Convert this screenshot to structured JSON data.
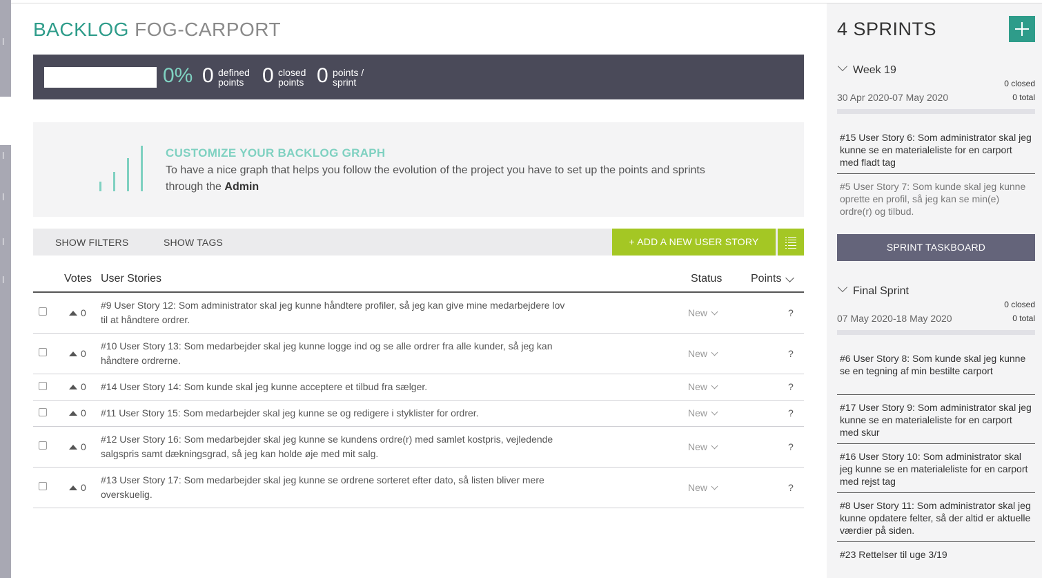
{
  "page": {
    "title_prefix": "BACKLOG",
    "title_project": "FOG-CARPORT"
  },
  "summary": {
    "percent": "0%",
    "defined_value": "0",
    "defined_label_1": "defined",
    "defined_label_2": "points",
    "closed_value": "0",
    "closed_label_1": "closed",
    "closed_label_2": "points",
    "sprint_value": "0",
    "sprint_label_1": "points /",
    "sprint_label_2": "sprint"
  },
  "graph_box": {
    "title": "CUSTOMIZE YOUR BACKLOG GRAPH",
    "text": "To have a nice graph that helps you follow the evolution of the project you have to set up the points and sprints through the",
    "link": "Admin"
  },
  "toolbar": {
    "show_filters": "SHOW FILTERS",
    "show_tags": "SHOW TAGS",
    "add_story": "+ ADD A NEW USER STORY"
  },
  "table": {
    "headers": {
      "votes": "Votes",
      "stories": "User Stories",
      "status": "Status",
      "points": "Points"
    },
    "rows": [
      {
        "votes": "0",
        "story": "#9 User Story 12: Som administrator skal jeg kunne håndtere profiler, så jeg kan give mine medarbejdere lov til at håndtere ordrer.",
        "status": "New",
        "points": "?"
      },
      {
        "votes": "0",
        "story": "#10 User Story 13: Som medarbejder skal jeg kunne logge ind og se alle ordrer fra alle kunder, så jeg kan håndtere ordrerne.",
        "status": "New",
        "points": "?"
      },
      {
        "votes": "0",
        "story": "#14 User Story 14: Som kunde skal jeg kunne acceptere et tilbud fra sælger.",
        "status": "New",
        "points": "?"
      },
      {
        "votes": "0",
        "story": "#11 User Story 15: Som medarbejder skal jeg kunne se og redigere i styklister for ordrer.",
        "status": "New",
        "points": "?"
      },
      {
        "votes": "0",
        "story": "#12 User Story 16: Som medarbejder skal jeg kunne se kundens ordre(r) med samlet kostpris, vejledende salgspris samt dækningsgrad, så jeg kan holde øje med mit salg.",
        "status": "New",
        "points": "?"
      },
      {
        "votes": "0",
        "story": "#13 User Story 17: Som medarbejder skal jeg kunne se ordrene sorteret efter dato, så listen bliver mere overskuelig.",
        "status": "New",
        "points": "?"
      }
    ]
  },
  "sidebar": {
    "title": "4 SPRINTS",
    "taskboard_label": "SPRINT TASKBOARD",
    "sprints": [
      {
        "name": "Week 19",
        "closed": "0 closed",
        "total": "0 total",
        "dates": "30 Apr 2020-07 May 2020",
        "items": [
          "#15 User Story 6: Som administrator skal jeg kunne se en materialeliste for en carport med fladt tag",
          "#5 User Story 7: Som kunde skal jeg kunne oprette en profil, så jeg kan se min(e) ordre(r) og tilbud."
        ]
      },
      {
        "name": "Final Sprint",
        "closed": "0 closed",
        "total": "0 total",
        "dates": "07 May 2020-18 May 2020",
        "items": [
          "#6 User Story 8: Som kunde skal jeg kunne se en tegning af min bestilte carport",
          "#17 User Story 9: Som administrator skal jeg kunne se en materialeliste for en carport med skur",
          "#16 User Story 10: Som administrator skal jeg kunne se en materialeliste for en carport med rejst tag",
          "#8 User Story 11: Som administrator skal jeg kunne opdatere felter, så der altid er aktuelle værdier på siden.",
          "#23 Rettelser til uge 3/19"
        ]
      }
    ]
  },
  "colors": {
    "accent_teal": "#2e9c8a",
    "accent_light_teal": "#7fd1c1",
    "accent_green": "#a4c724",
    "summary_bg": "#4a4a59",
    "taskboard_bg": "#64647a"
  }
}
